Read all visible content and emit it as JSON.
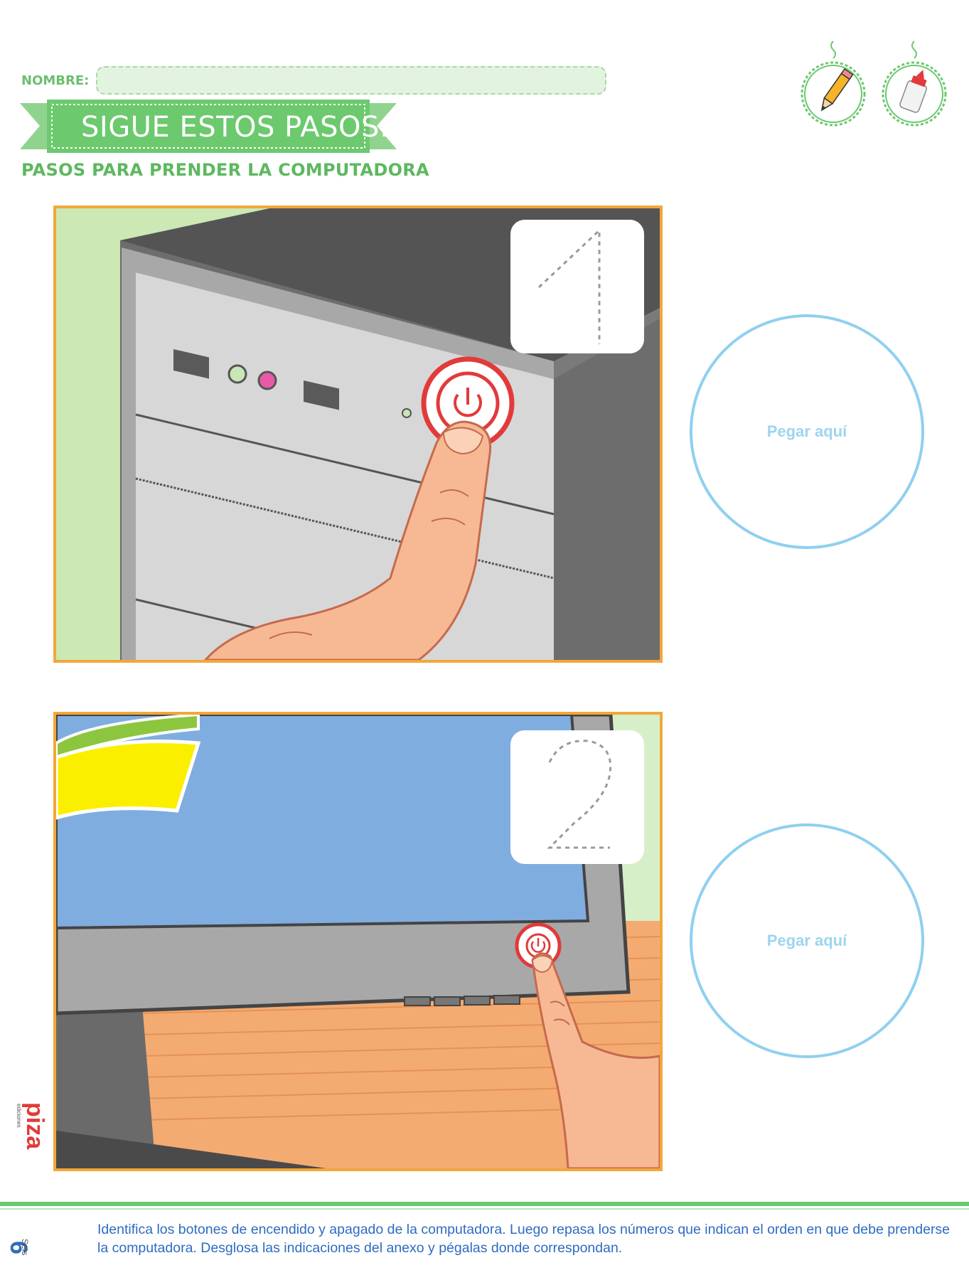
{
  "header": {
    "name_label": "NOMBRE:",
    "banner_title": "SIGUE ESTOS PASOS:",
    "subtitle": "PASOS PARA PRENDER LA COMPUTADORA"
  },
  "tools": [
    {
      "icon": "pencil-icon"
    },
    {
      "icon": "glue-icon"
    }
  ],
  "steps": [
    {
      "number": "1",
      "paste_label": "Pegar aquí",
      "scene": "computer-tower-power-button"
    },
    {
      "number": "2",
      "paste_label": "Pegar aquí",
      "scene": "monitor-power-button"
    }
  ],
  "footer": {
    "page_number": "6",
    "page_word": "Seis",
    "instructions": "Identifica los botones de encendido y apagado de la computadora. Luego repasa los números que indican el orden en que debe prenderse la computadora. Desglosa las indicaciones del anexo y pégalas donde correspondan.",
    "publisher": "Piza ediciones"
  },
  "colors": {
    "green": "#6cbf6e",
    "orange_frame": "#f2a73a",
    "paste_circle": "#8fd0ef",
    "text_blue": "#2d6cc0",
    "power_red": "#e23a3a"
  }
}
